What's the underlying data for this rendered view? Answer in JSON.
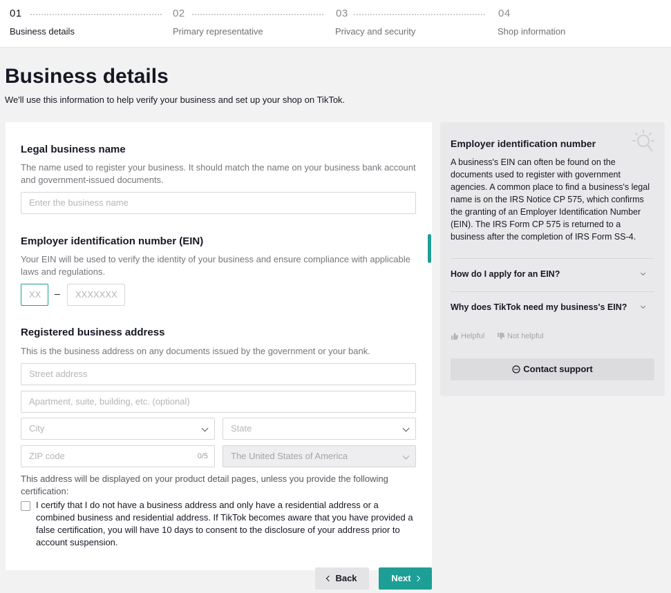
{
  "steps": [
    {
      "number": "01",
      "label": "Business details",
      "active": true
    },
    {
      "number": "02",
      "label": "Primary representative",
      "active": false
    },
    {
      "number": "03",
      "label": "Privacy and security",
      "active": false
    },
    {
      "number": "04",
      "label": "Shop information",
      "active": false
    }
  ],
  "page": {
    "title": "Business details",
    "subtitle": "We'll use this information to help verify your business and set up your shop on TikTok."
  },
  "legal_name": {
    "title": "Legal business name",
    "help": "The name used to register your business. It should match the name on your business bank account and government-issued documents.",
    "placeholder": "Enter the business name",
    "value": ""
  },
  "ein": {
    "title": "Employer identification number (EIN)",
    "help": "Your EIN will be used to verify the identity of your business and ensure compliance with applicable laws and regulations.",
    "prefix_placeholder": "XX",
    "separator": "–",
    "suffix_placeholder": "XXXXXXX"
  },
  "address": {
    "title": "Registered business address",
    "help": "This is the business address on any documents issued by the government or your bank.",
    "street_placeholder": "Street address",
    "apt_placeholder": "Apartment, suite, building, etc. (optional)",
    "city_placeholder": "City",
    "state_placeholder": "State",
    "zip_placeholder": "ZIP code",
    "zip_counter": "0/5",
    "country_value": "The United States of America",
    "display_note": "This address will be displayed on your product detail pages, unless you provide the following certification:",
    "certify_text": "I certify that I do not have a business address and only have a residential address or a combined business and residential address. If TikTok becomes aware that you have provided a false certification, you will have 10 days to consent to the disclosure of your address prior to account suspension.",
    "certify_checked": false
  },
  "buttons": {
    "back": "Back",
    "next": "Next"
  },
  "help_panel": {
    "title": "Employer identification number",
    "body": "A business's EIN can often be found on the documents used to register with government agencies. A common place to find a business's legal name is on the IRS Notice CP 575, which confirms the granting of an Employer Identification Number (EIN). The IRS Form CP 575 is returned to a business after the completion of IRS Form SS-4.",
    "faqs": [
      "How do I apply for an EIN?",
      "Why does TikTok need my business's EIN?"
    ],
    "helpful": "Helpful",
    "not_helpful": "Not helpful",
    "contact_support": "Contact support"
  },
  "colors": {
    "accent": "#1d9f96",
    "background": "#f2f2f2",
    "card": "#ffffff",
    "text": "#161823"
  }
}
